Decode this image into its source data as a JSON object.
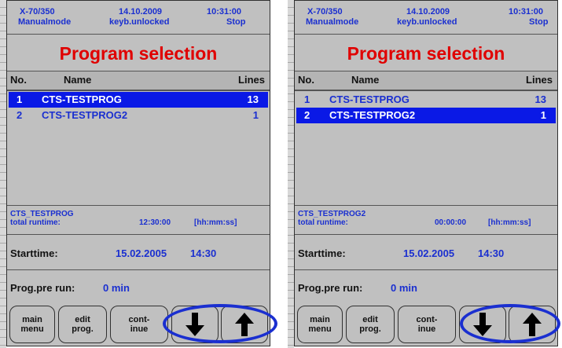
{
  "screens": [
    {
      "header": {
        "machine": "X-70/350",
        "date": "14.10.2009",
        "time": "10:31:00",
        "mode": "Manualmode",
        "keyboard": "keyb.unlocked",
        "state": "Stop"
      },
      "title": "Program selection",
      "columns": {
        "no": "No.",
        "name": "Name",
        "lines": "Lines"
      },
      "programs": [
        {
          "no": "1",
          "name": "CTS-TESTPROG",
          "lines": "13",
          "selected": true
        },
        {
          "no": "2",
          "name": "CTS-TESTPROG2",
          "lines": "1",
          "selected": false
        }
      ],
      "info": {
        "program": "CTS_TESTPROG",
        "runtime_label": "total runtime:",
        "runtime": "12:30:00",
        "unit": "[hh:mm:ss]"
      },
      "starttime": {
        "label": "Starttime:",
        "date": "15.02.2005",
        "time": "14:30"
      },
      "prerun": {
        "label": "Prog.pre run:",
        "value": "0 min"
      },
      "buttons": {
        "main_1": "main",
        "main_2": "menu",
        "edit_1": "edit",
        "edit_2": "prog.",
        "cont_1": "cont-",
        "cont_2": "inue",
        "down_icon": "arrow-down-icon",
        "up_icon": "arrow-up-icon"
      }
    },
    {
      "header": {
        "machine": "X-70/350",
        "date": "14.10.2009",
        "time": "10:31:00",
        "mode": "Manualmode",
        "keyboard": "keyb.unlocked",
        "state": "Stop"
      },
      "title": "Program selection",
      "columns": {
        "no": "No.",
        "name": "Name",
        "lines": "Lines"
      },
      "programs": [
        {
          "no": "1",
          "name": "CTS-TESTPROG",
          "lines": "13",
          "selected": false
        },
        {
          "no": "2",
          "name": "CTS-TESTPROG2",
          "lines": "1",
          "selected": true
        }
      ],
      "info": {
        "program": "CTS_TESTPROG2",
        "runtime_label": "total runtime:",
        "runtime": "00:00:00",
        "unit": "[hh:mm:ss]"
      },
      "starttime": {
        "label": "Starttime:",
        "date": "15.02.2005",
        "time": "14:30"
      },
      "prerun": {
        "label": "Prog.pre run:",
        "value": "0 min"
      },
      "buttons": {
        "main_1": "main",
        "main_2": "menu",
        "edit_1": "edit",
        "edit_2": "prog.",
        "cont_1": "cont-",
        "cont_2": "inue",
        "down_icon": "arrow-down-icon",
        "up_icon": "arrow-up-icon"
      }
    }
  ],
  "colors": {
    "title": "#e00000",
    "text": "#1a2fd0",
    "selection": "#0a19e6",
    "panel": "#c0c0c0",
    "highlight_oval": "#1a2fd0"
  }
}
